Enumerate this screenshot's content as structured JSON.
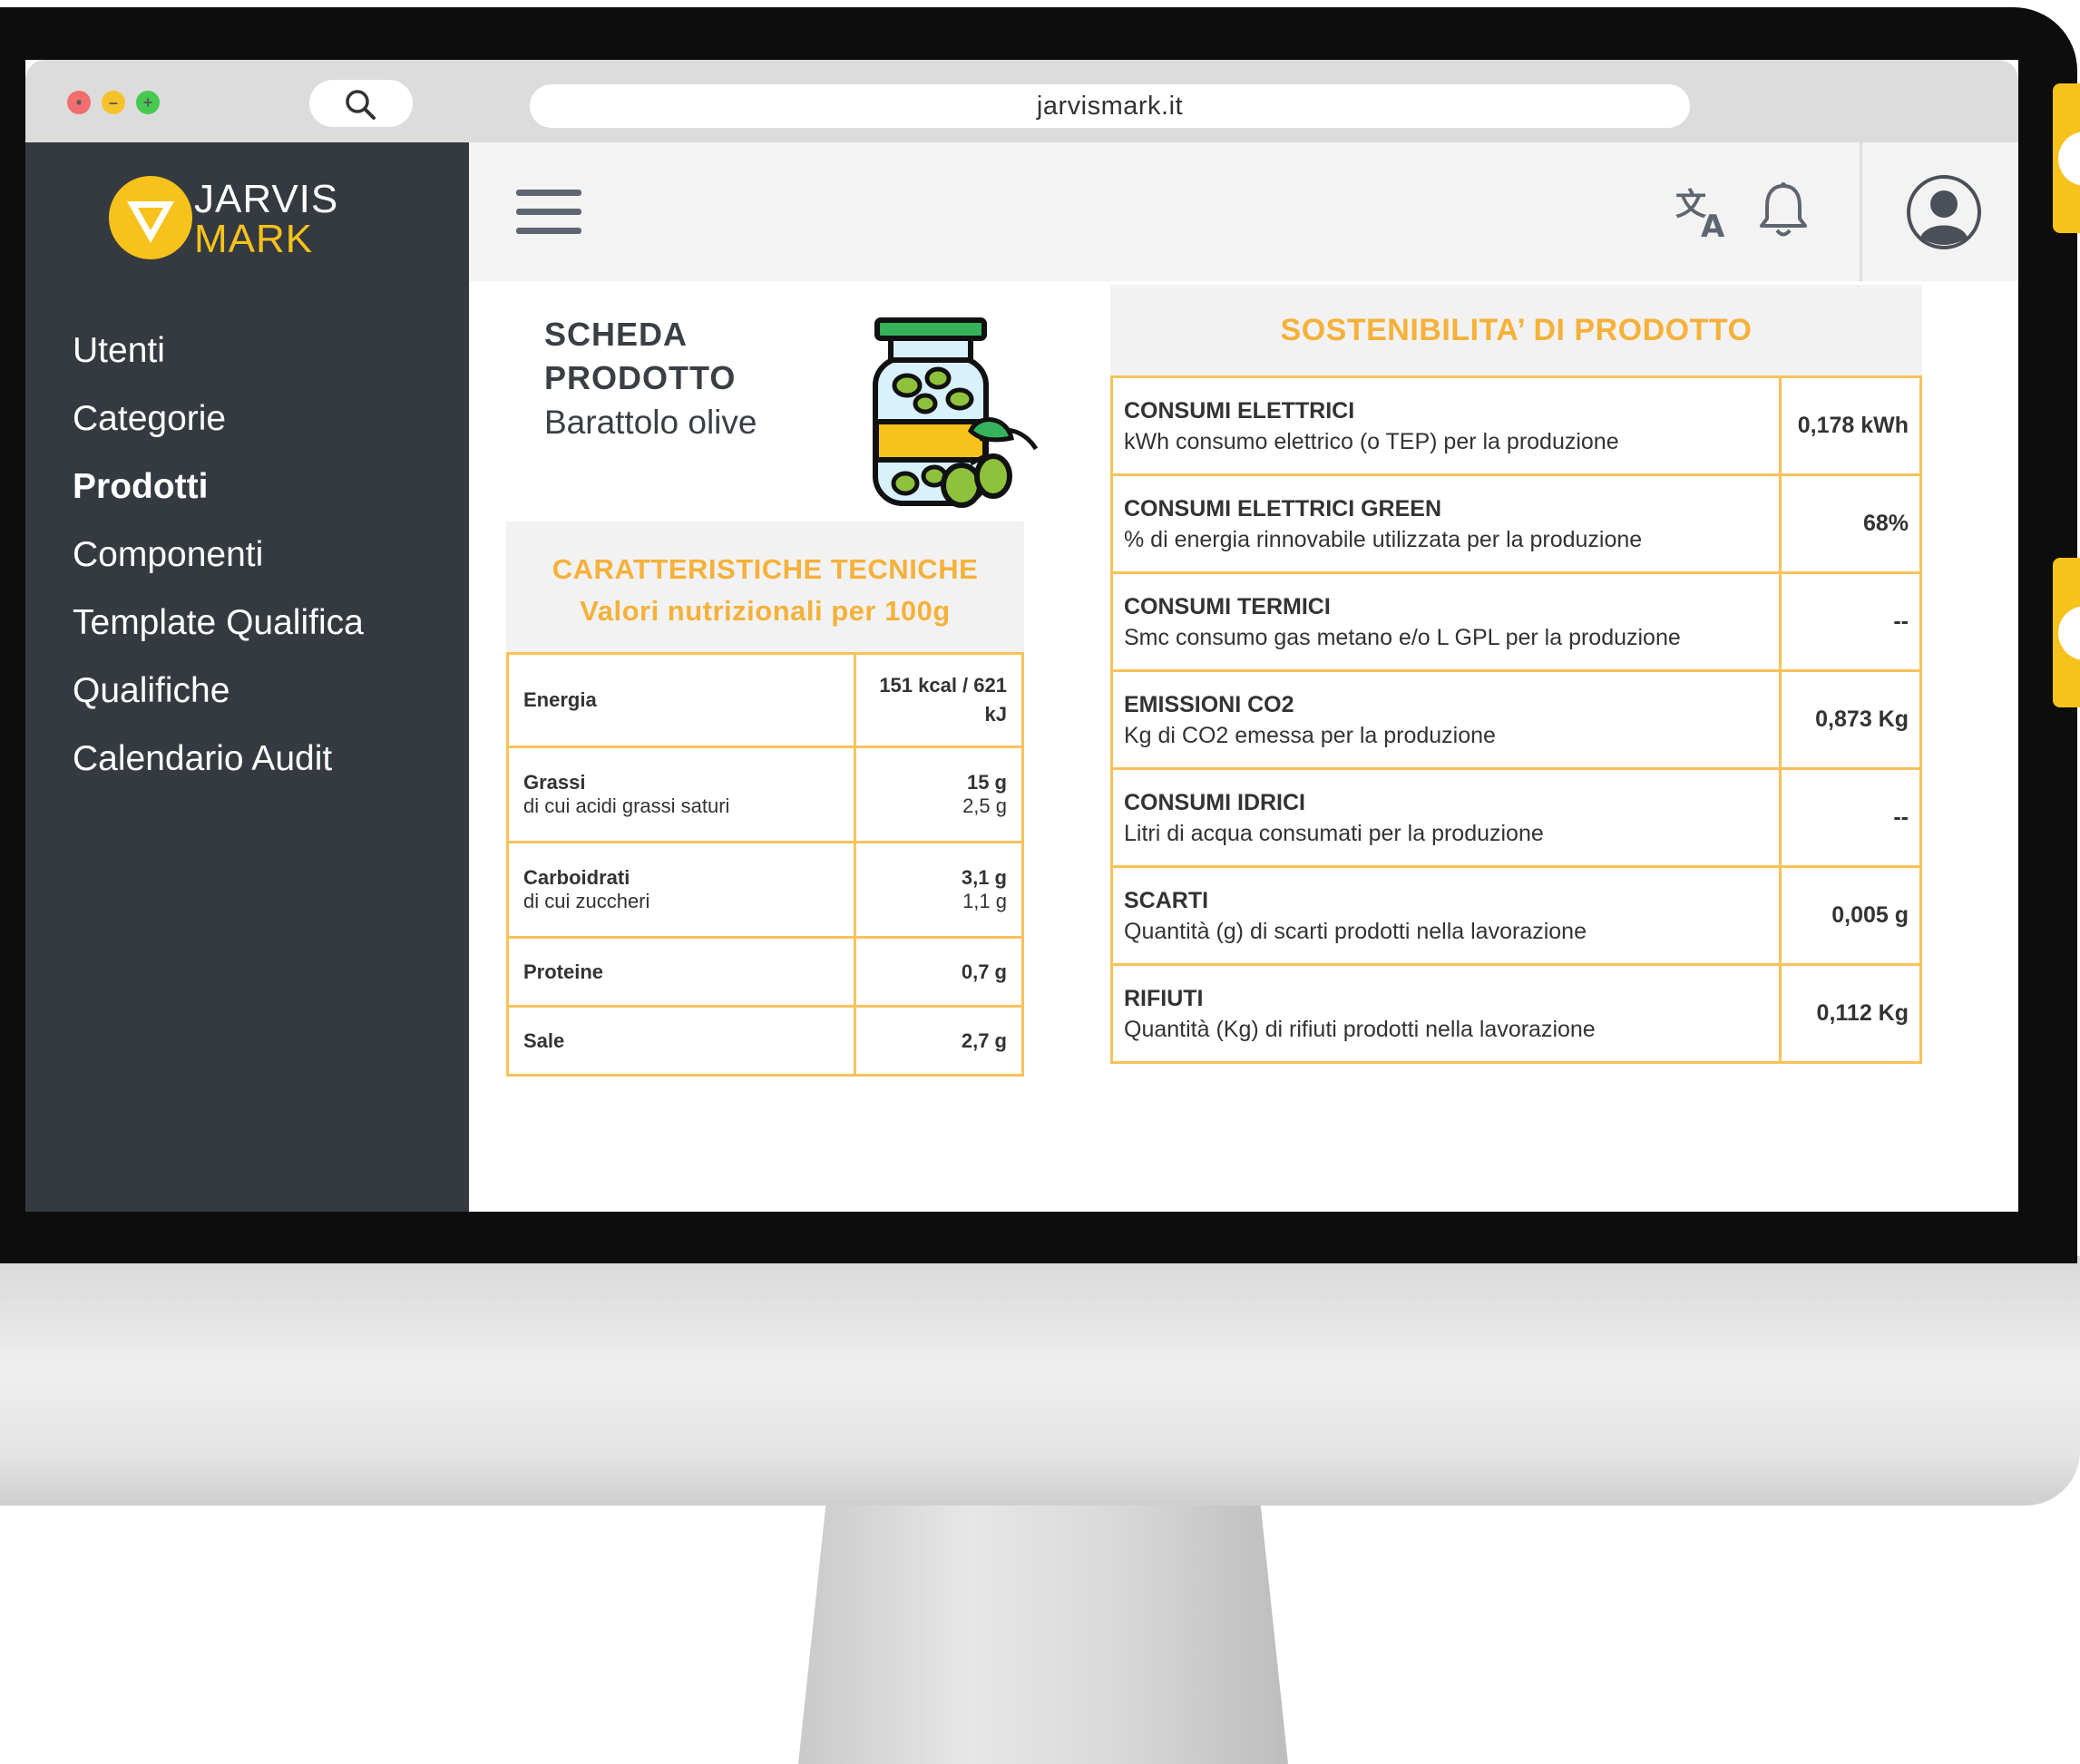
{
  "browser": {
    "url": "jarvismark.it"
  },
  "brand": {
    "line1": "JARVIS",
    "line2": "MARK",
    "accent": "#f7c21b"
  },
  "sidebar": {
    "items": [
      {
        "label": "Utenti",
        "active": false
      },
      {
        "label": "Categorie",
        "active": false
      },
      {
        "label": "Prodotti",
        "active": true
      },
      {
        "label": "Componenti",
        "active": false
      },
      {
        "label": "Template Qualifica",
        "active": false
      },
      {
        "label": "Qualifiche",
        "active": false
      },
      {
        "label": "Calendario Audit",
        "active": false
      }
    ]
  },
  "topbar": {
    "icons": [
      "menu-icon",
      "translate-icon",
      "bell-icon",
      "avatar-icon"
    ]
  },
  "product": {
    "title_line1": "SCHEDA",
    "title_line2": "PRODOTTO",
    "name": "Barattolo olive",
    "icon": "olive-jar-icon"
  },
  "tech": {
    "heading1": "CARATTERISTICHE TECNICHE",
    "heading2": "Valori nutrizionali per 100g",
    "rows": [
      {
        "label": "Energia",
        "sub": "",
        "value": "151 kcal / 621 kJ",
        "value_sub": ""
      },
      {
        "label": "Grassi",
        "sub": "di cui acidi grassi saturi",
        "value": "15 g",
        "value_sub": "2,5 g"
      },
      {
        "label": "Carboidrati",
        "sub": "di cui zuccheri",
        "value": "3,1 g",
        "value_sub": "1,1 g"
      },
      {
        "label": "Proteine",
        "sub": "",
        "value": "0,7 g",
        "value_sub": ""
      },
      {
        "label": "Sale",
        "sub": "",
        "value": "2,7 g",
        "value_sub": ""
      }
    ]
  },
  "sustainability": {
    "heading": "SOSTENIBILITA’ DI PRODOTTO",
    "rows": [
      {
        "label": "CONSUMI ELETTRICI",
        "desc": "kWh consumo elettrico (o TEP) per la produzione",
        "value": "0,178 kWh"
      },
      {
        "label": "CONSUMI ELETTRICI GREEN",
        "desc": "% di energia rinnovabile utilizzata per la produzione",
        "value": "68%"
      },
      {
        "label": "CONSUMI TERMICI",
        "desc": "Smc consumo gas metano e/o L GPL per la produzione",
        "value": "--"
      },
      {
        "label": "EMISSIONI CO2",
        "desc": "Kg di CO2 emessa per la produzione",
        "value": "0,873 Kg"
      },
      {
        "label": "CONSUMI IDRICI",
        "desc": "Litri di acqua consumati per la produzione",
        "value": "--"
      },
      {
        "label": "SCARTI",
        "desc": "Quantità (g) di scarti prodotti nella lavorazione",
        "value": "0,005 g"
      },
      {
        "label": "RIFIUTI",
        "desc": "Quantità (Kg) di rifiuti prodotti nella lavorazione",
        "value": "0,112 Kg"
      }
    ]
  }
}
